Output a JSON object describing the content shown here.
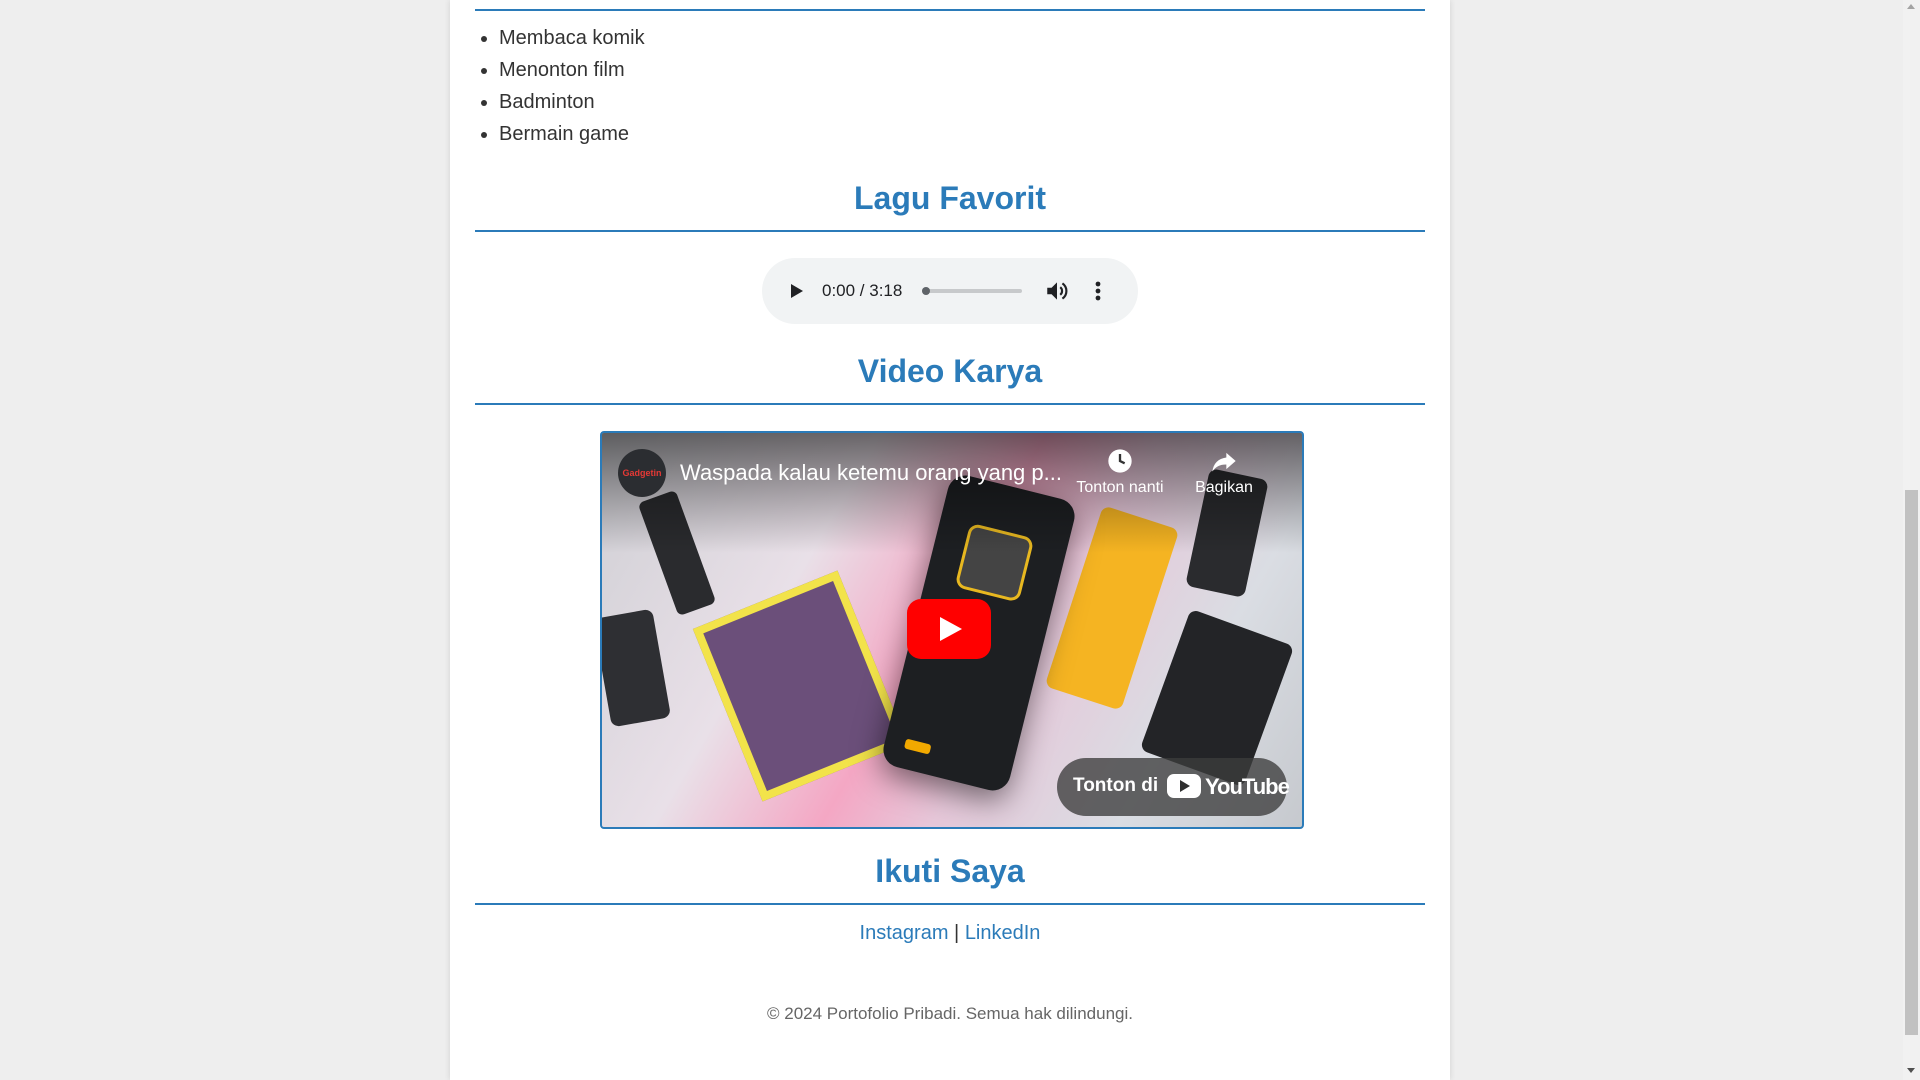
{
  "hobbies": [
    "Membaca komik",
    "Menonton film",
    "Badminton",
    "Bermain game"
  ],
  "sections": {
    "music_title": "Lagu Favorit",
    "video_title": "Video Karya",
    "social_title": "Ikuti Saya"
  },
  "audio": {
    "time": "0:00 / 3:18",
    "progress": 0
  },
  "video": {
    "title": "Waspada kalau ketemu orang yang p...",
    "channel_badge": "Gadgetin",
    "watch_later": "Tonton nanti",
    "share": "Bagikan",
    "watch_on": "Tonton di",
    "youtube": "YouTube"
  },
  "social": {
    "instagram": "Instagram",
    "separator": "|",
    "linkedin": "LinkedIn"
  },
  "footer": "© 2024 Portofolio Pribadi. Semua hak dilindungi.",
  "colors": {
    "accent": "#2b7bb9",
    "page_bg": "#eeeeee",
    "youtube_red": "#ff0000"
  }
}
